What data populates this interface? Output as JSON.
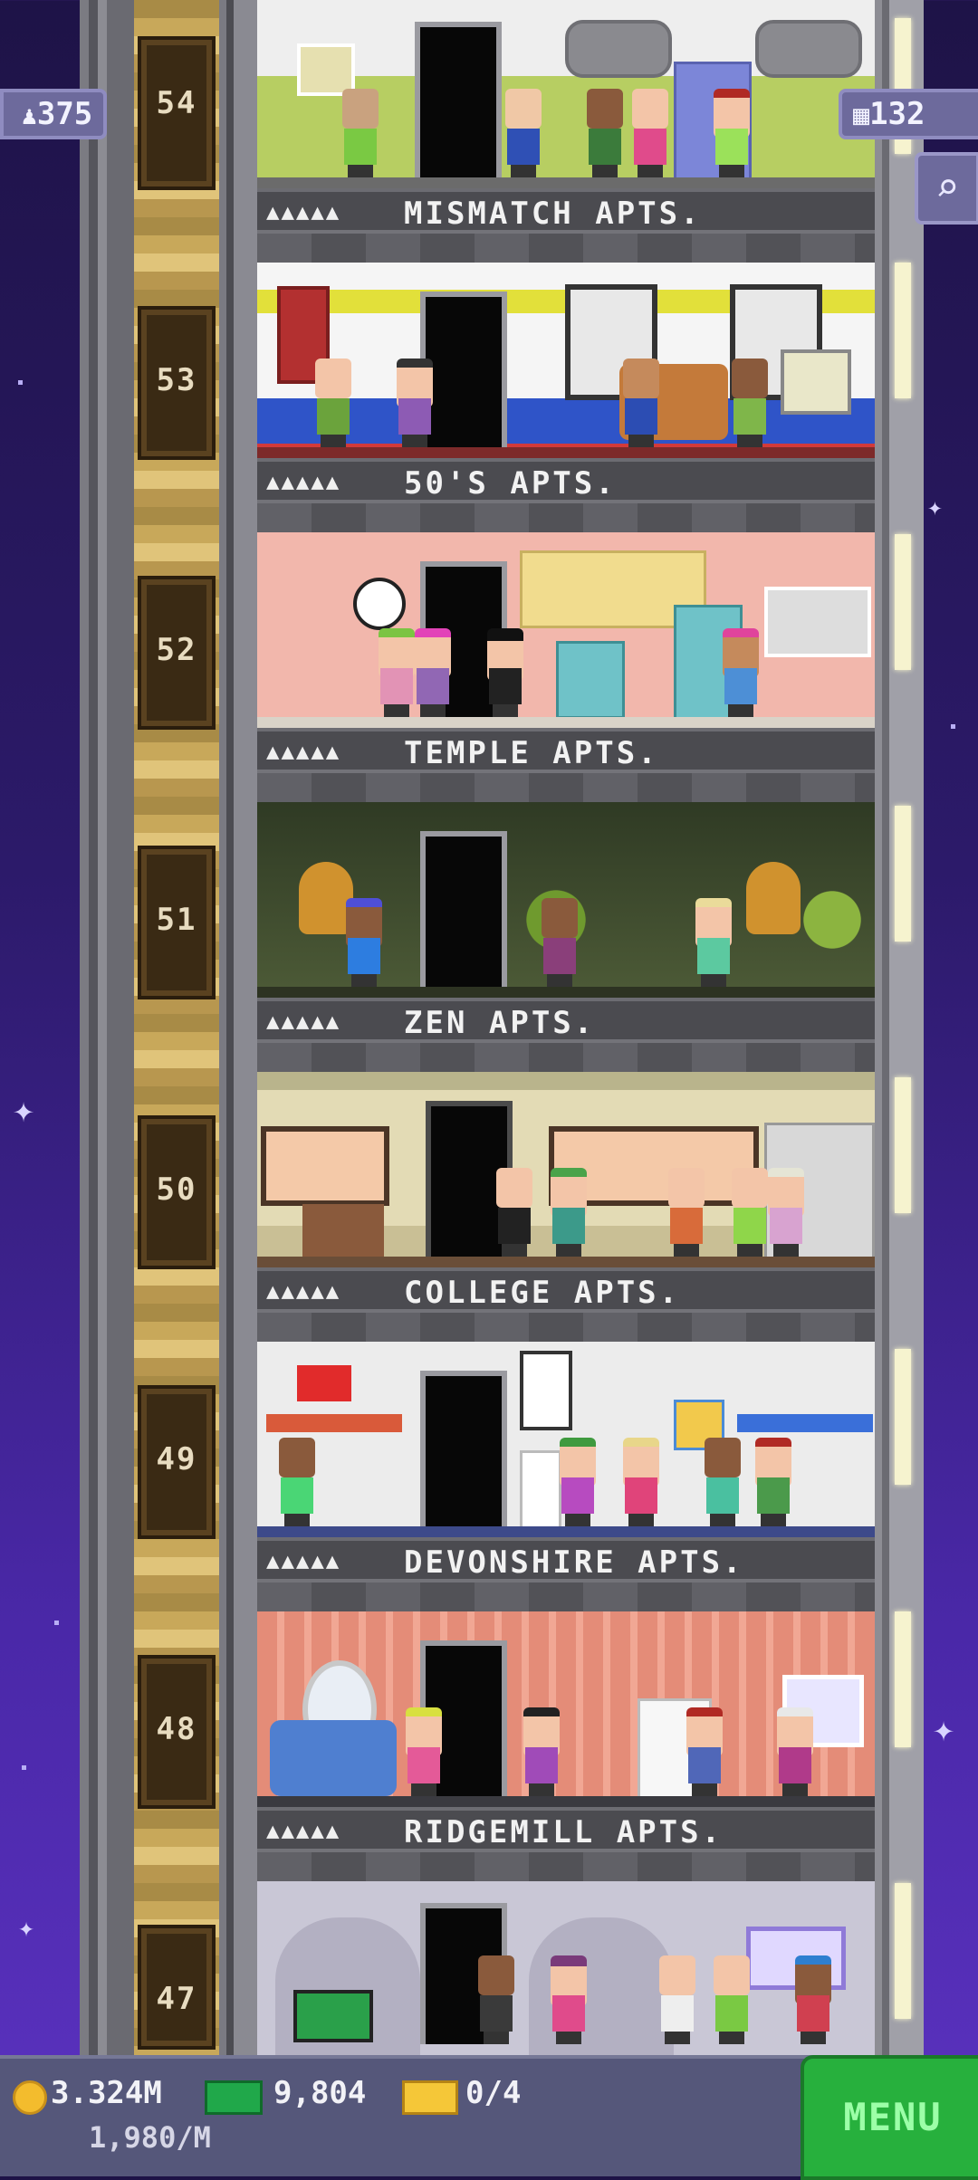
{
  "hud": {
    "population": "375",
    "floors_count": "132",
    "search_icon": "magnifier-icon",
    "person_icon": "person-icon",
    "building_icon": "building-icon"
  },
  "floors": [
    {
      "number": "54",
      "name": "MISMATCH APTS.",
      "stars": "▲▲▲▲▲",
      "wall": "#e9e7e4",
      "accent": "#b5cc63"
    },
    {
      "number": "53",
      "name": "50'S APTS.",
      "stars": "▲▲▲▲▲",
      "wall": "#f0f0f0",
      "accent": "#d9d92a"
    },
    {
      "number": "52",
      "name": "TEMPLE APTS.",
      "stars": "▲▲▲▲▲",
      "wall": "#f1b7ad",
      "accent": "#f0d98c"
    },
    {
      "number": "51",
      "name": "ZEN APTS.",
      "stars": "▲▲▲▲▲",
      "wall": "#3f4a30",
      "accent": "#5c6b42"
    },
    {
      "number": "50",
      "name": "COLLEGE APTS.",
      "stars": "▲▲▲▲▲",
      "wall": "#d8cfa6",
      "accent": "#c7b98a"
    },
    {
      "number": "49",
      "name": "DEVONSHIRE APTS.",
      "stars": "▲▲▲▲▲",
      "wall": "#e8e6e6",
      "accent": "#c9c6c6"
    },
    {
      "number": "48",
      "name": "RIDGEMILL APTS.",
      "stars": "▲▲▲▲▲",
      "wall": "#e99a86",
      "accent": "#f3b4a2"
    },
    {
      "number": "47",
      "name": "",
      "stars": "",
      "wall": "#c9c7d6",
      "accent": "#a9a6bb"
    }
  ],
  "bottom": {
    "coins": "3.324M",
    "coin_rate": "1,980/M",
    "bux": "9,804",
    "tickets": "0/4",
    "menu_label": "MENU"
  },
  "colors": {
    "menu": "#27b03d",
    "hud_pill": "#6d6a9c",
    "sky": "#2c1a6a"
  }
}
